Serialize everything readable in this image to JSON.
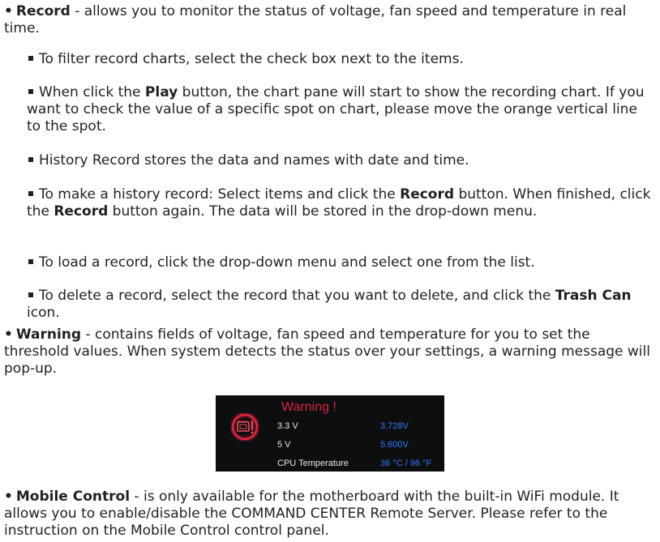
{
  "record": {
    "title": "Record",
    "text": " - allows you to monitor the status of voltage, fan speed and temperature in real time.",
    "items": [
      {
        "t1": "To filter record charts, select the check box next to the items."
      },
      {
        "t1": "When click the ",
        "b1": "Play",
        "t2": " button, the chart pane will start to show the recording chart. If you want to check the value of a specific spot on chart, please move the orange vertical line to the spot."
      },
      {
        "t1": "History Record stores the data and names with date and time."
      },
      {
        "t1": "To make a history record: Select items and click the ",
        "b1": "Record",
        "t2": " button. When finished, click the ",
        "b2": "Record",
        "t3": " button again. The data will be stored in the drop-down menu."
      },
      {
        "t1": "To load a record, click the drop-down menu and select one from the list."
      },
      {
        "t1": "To delete a record, select the record that you want to delete, and click the ",
        "b1": "Trash Can",
        "t2": " icon."
      }
    ]
  },
  "warning": {
    "title": "Warning",
    "text": " - contains fields of voltage, fan speed and temperature for you to set the threshold values. When system detects the status over your settings, a warning message will pop-up."
  },
  "popup": {
    "title": "Warning !",
    "icon": "warning-chip-icon",
    "accent": "#d7263d",
    "value_color": "#2d7cff",
    "rows": [
      {
        "label": "3.3 V",
        "value": "3.728V"
      },
      {
        "label": "5 V",
        "value": "5.600V"
      },
      {
        "label": "CPU Temperature",
        "value": "36 °C / 96 °F"
      }
    ]
  },
  "mobile": {
    "title": "Mobile Control",
    "text": " - is only available for the motherboard with the built-in WiFi module. It allows you to enable/disable the COMMAND CENTER Remote Server. Please refer to the instruction on the Mobile Control control panel."
  }
}
